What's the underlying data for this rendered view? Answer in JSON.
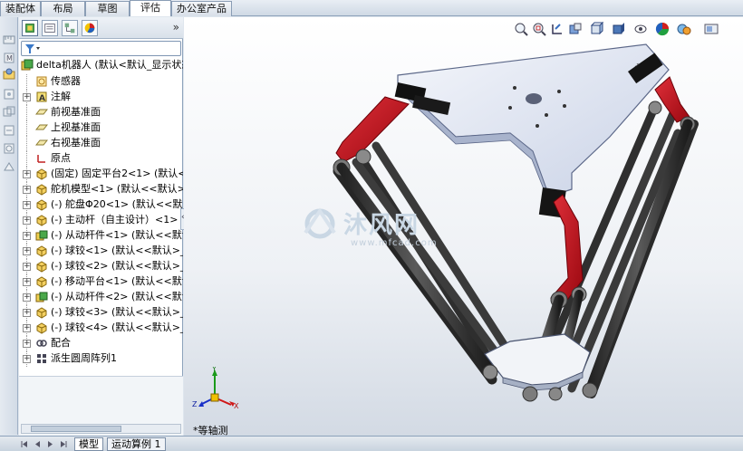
{
  "cmd_tabs": [
    {
      "label": "装配体",
      "active": false
    },
    {
      "label": "布局",
      "active": false
    },
    {
      "label": "草图",
      "active": false
    },
    {
      "label": "评估",
      "active": true
    },
    {
      "label": "办公室产品",
      "active": false
    }
  ],
  "feature_tree": {
    "root": "delta机器人  (默认<默认_显示状态",
    "items": [
      {
        "label": "传感器",
        "icon": "sensor-icon",
        "expandable": false
      },
      {
        "label": "注解",
        "icon": "annotation-icon",
        "expandable": true
      },
      {
        "label": "前视基准面",
        "icon": "plane-icon",
        "expandable": false
      },
      {
        "label": "上视基准面",
        "icon": "plane-icon",
        "expandable": false
      },
      {
        "label": "右视基准面",
        "icon": "plane-icon",
        "expandable": false
      },
      {
        "label": "原点",
        "icon": "origin-icon",
        "expandable": false
      },
      {
        "label": "(固定) 固定平台2<1> (默认<<",
        "icon": "part-icon",
        "expandable": true
      },
      {
        "label": "舵机模型<1> (默认<<默认>_显",
        "icon": "part-icon",
        "expandable": true
      },
      {
        "label": "(-) 舵盘Φ20<1> (默认<<默认",
        "icon": "part-icon",
        "expandable": true
      },
      {
        "label": "(-) 主动杆（自主设计）<1> (默",
        "icon": "part-icon",
        "expandable": true
      },
      {
        "label": "(-) 从动杆件<1> (默认<<默认_显",
        "icon": "subassembly-icon",
        "expandable": true
      },
      {
        "label": "(-) 球铰<1> (默认<<默认>_显",
        "icon": "part-icon",
        "expandable": true
      },
      {
        "label": "(-) 球铰<2> (默认<<默认>_显",
        "icon": "part-icon",
        "expandable": true
      },
      {
        "label": "(-) 移动平台<1> (默认<<默认",
        "icon": "part-icon",
        "expandable": true
      },
      {
        "label": "(-) 从动杆件<2> (默认<<默认_显",
        "icon": "subassembly-icon",
        "expandable": true
      },
      {
        "label": "(-) 球铰<3> (默认<<默认>_显",
        "icon": "part-icon",
        "expandable": true
      },
      {
        "label": "(-) 球铰<4> (默认<<默认>_显",
        "icon": "part-icon",
        "expandable": true
      },
      {
        "label": "配合",
        "icon": "mates-icon",
        "expandable": true
      },
      {
        "label": "派生圆周阵列1",
        "icon": "pattern-icon",
        "expandable": true
      }
    ]
  },
  "graphics": {
    "view_label": "*等轴测",
    "watermark_main": "沐风网",
    "watermark_sub": "www.mfcad.com",
    "axis_labels": {
      "x": "X",
      "y": "Y",
      "z": "Z"
    }
  },
  "bottom_tabs": [
    {
      "label": "模型",
      "active": true
    },
    {
      "label": "运动算例 1",
      "active": false
    }
  ],
  "colors": {
    "arm_red": "#c0101a",
    "rod_dark": "#3a3a3a",
    "platform": "#e4e9f5"
  }
}
